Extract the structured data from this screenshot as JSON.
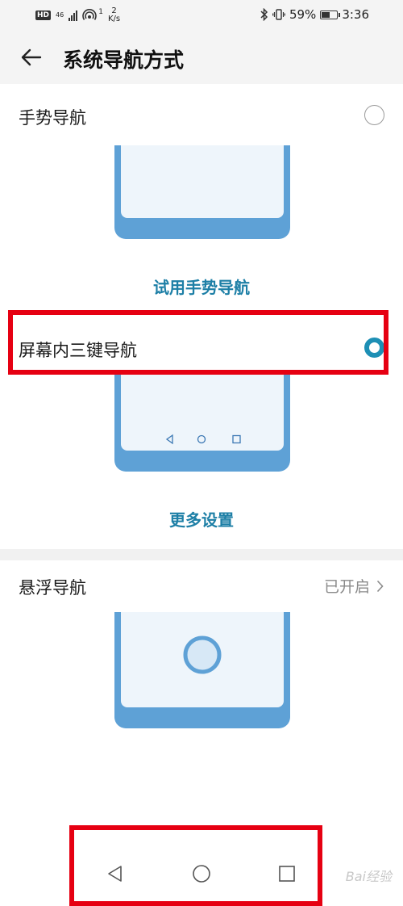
{
  "status_bar": {
    "hd": "HD",
    "net_type": "46",
    "hotspot_count": "1",
    "speed_value": "2",
    "speed_unit": "K/s",
    "battery_percent": "59%",
    "battery_level": 0.59,
    "time": "3:36"
  },
  "header": {
    "title": "系统导航方式"
  },
  "gesture": {
    "label": "手势导航",
    "try_link": "试用手势导航"
  },
  "three_key": {
    "label": "屏幕内三键导航",
    "more_link": "更多设置"
  },
  "floating": {
    "label": "悬浮导航",
    "status": "已开启"
  },
  "nav_bar": {
    "watermark": "Bai经验"
  },
  "colors": {
    "accent": "#1d8fb5",
    "highlight": "#e60012",
    "phone_frame": "#5ea1d6"
  }
}
